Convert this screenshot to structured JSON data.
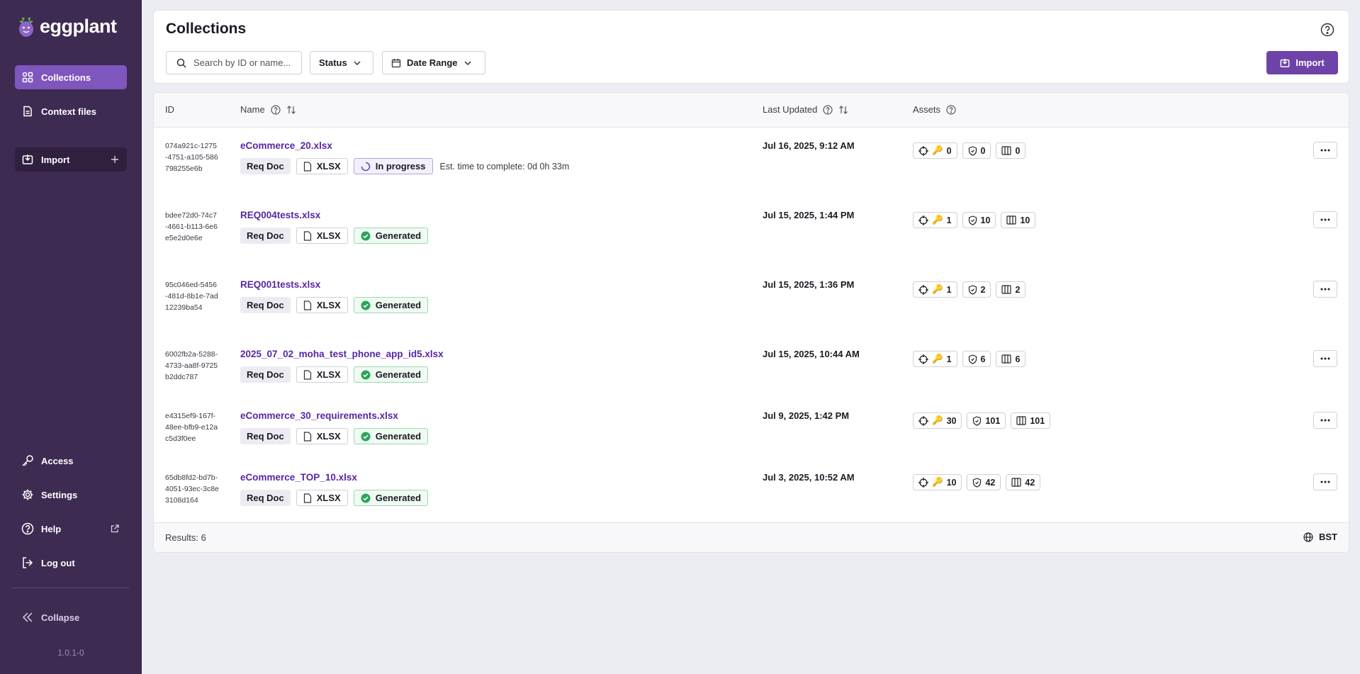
{
  "app": {
    "logo_text": "eggplant",
    "version": "1.0.1-0"
  },
  "sidebar": {
    "items": [
      {
        "label": "Collections",
        "icon": "grid-icon"
      },
      {
        "label": "Context files",
        "icon": "document-icon"
      },
      {
        "label": "Import",
        "icon": "import-icon"
      }
    ],
    "bottom": [
      {
        "label": "Access",
        "icon": "key-icon"
      },
      {
        "label": "Settings",
        "icon": "gear-icon"
      },
      {
        "label": "Help",
        "icon": "help-icon"
      },
      {
        "label": "Log out",
        "icon": "logout-icon"
      }
    ],
    "collapse_label": "Collapse"
  },
  "header": {
    "title": "Collections",
    "search_placeholder": "Search by ID or name...",
    "status_label": "Status",
    "date_label": "Date Range",
    "import_label": "Import"
  },
  "table": {
    "columns": {
      "id": "ID",
      "name": "Name",
      "updated": "Last Updated",
      "assets": "Assets"
    },
    "rows": [
      {
        "id": "074a921c-1275-4751-a105-586798255e6b",
        "name": "eCommerce_20.xlsx",
        "type": "Req Doc",
        "format": "XLSX",
        "status": "In progress",
        "est": "Est. time to complete: 0d 0h 33m",
        "updated": "Jul 16, 2025, 9:12 AM",
        "a1": "0",
        "a2": "0",
        "a3": "0"
      },
      {
        "id": "bdee72d0-74c7-4661-b113-6e6e5e2d0e6e",
        "name": "REQ004tests.xlsx",
        "type": "Req Doc",
        "format": "XLSX",
        "status": "Generated",
        "est": "",
        "updated": "Jul 15, 2025, 1:44 PM",
        "a1": "1",
        "a2": "10",
        "a3": "10"
      },
      {
        "id": "95c046ed-5456-481d-8b1e-7ad12239ba54",
        "name": "REQ001tests.xlsx",
        "type": "Req Doc",
        "format": "XLSX",
        "status": "Generated",
        "est": "",
        "updated": "Jul 15, 2025, 1:36 PM",
        "a1": "1",
        "a2": "2",
        "a3": "2"
      },
      {
        "id": "6002fb2a-5288-4733-aa8f-9725b2ddc787",
        "name": "2025_07_02_moha_test_phone_app_id5.xlsx",
        "type": "Req Doc",
        "format": "XLSX",
        "status": "Generated",
        "est": "",
        "updated": "Jul 15, 2025, 10:44 AM",
        "a1": "1",
        "a2": "6",
        "a3": "6"
      },
      {
        "id": "e4315ef9-167f-48ee-bfb9-e12ac5d3f0ee",
        "name": "eCommerce_30_requirements.xlsx",
        "type": "Req Doc",
        "format": "XLSX",
        "status": "Generated",
        "est": "",
        "updated": "Jul 9, 2025, 1:42 PM",
        "a1": "30",
        "a2": "101",
        "a3": "101"
      },
      {
        "id": "65db8fd2-bd7b-4051-93ec-3c8e3108d164",
        "name": "eCommerce_TOP_10.xlsx",
        "type": "Req Doc",
        "format": "XLSX",
        "status": "Generated",
        "est": "",
        "updated": "Jul 3, 2025, 10:52 AM",
        "a1": "10",
        "a2": "42",
        "a3": "42"
      }
    ],
    "results": "Results: 6",
    "timezone": "BST"
  }
}
